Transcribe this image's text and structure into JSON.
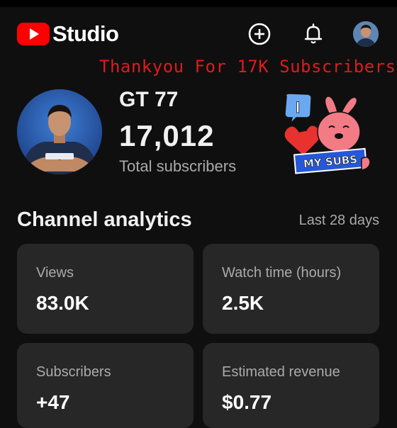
{
  "header": {
    "logo_text": "Studio",
    "add_icon": "plus-circle-icon",
    "notifications_icon": "bell-icon",
    "brand_color": "#ff0000"
  },
  "banner": {
    "text": "Thankyou For 17K Subscribers",
    "color": "#e01b1b"
  },
  "channel": {
    "name": "GT 77",
    "subscribers": "17,012",
    "subscribers_label": "Total subscribers"
  },
  "sticker": {
    "letter": "I",
    "text": "MY SUBS"
  },
  "analytics": {
    "title": "Channel analytics",
    "range": "Last 28 days",
    "cards": [
      {
        "label": "Views",
        "value": "83.0K"
      },
      {
        "label": "Watch time (hours)",
        "value": "2.5K"
      },
      {
        "label": "Subscribers",
        "value": "+47"
      },
      {
        "label": "Estimated revenue",
        "value": "$0.77"
      }
    ]
  }
}
